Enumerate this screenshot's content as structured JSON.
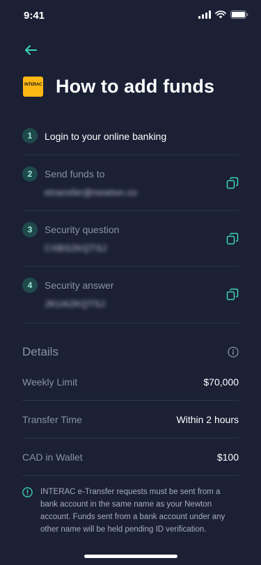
{
  "status_bar": {
    "time": "9:41"
  },
  "header": {
    "logo_text": "INTERAC",
    "title": "How to add funds"
  },
  "steps": [
    {
      "number": "1",
      "label": "Login to your online banking"
    },
    {
      "number": "2",
      "label": "Send funds to",
      "value": "etransfer@newton.co"
    },
    {
      "number": "3",
      "label": "Security question",
      "value": "CXBS2KQTSJ"
    },
    {
      "number": "4",
      "label": "Security answer",
      "value": "JKUA2KQTSJ"
    }
  ],
  "details": {
    "title": "Details",
    "rows": [
      {
        "key": "Weekly Limit",
        "value": "$70,000"
      },
      {
        "key": "Transfer Time",
        "value": "Within 2 hours"
      },
      {
        "key": "CAD in Wallet",
        "value": "$100"
      }
    ]
  },
  "notice": "INTERAC e-Transfer requests must be sent from a bank account in the same name as your Newton account. Funds sent from a bank account under any other name will be held pending ID verification.",
  "colors": {
    "background": "#1b2035",
    "accent": "#3ed6b5",
    "step_badge": "#1f4a4c",
    "muted": "#8a90a6"
  },
  "icons": [
    "back-arrow-icon",
    "copy-icon",
    "info-icon",
    "warning-icon",
    "signal-icon",
    "wifi-icon",
    "battery-icon"
  ]
}
